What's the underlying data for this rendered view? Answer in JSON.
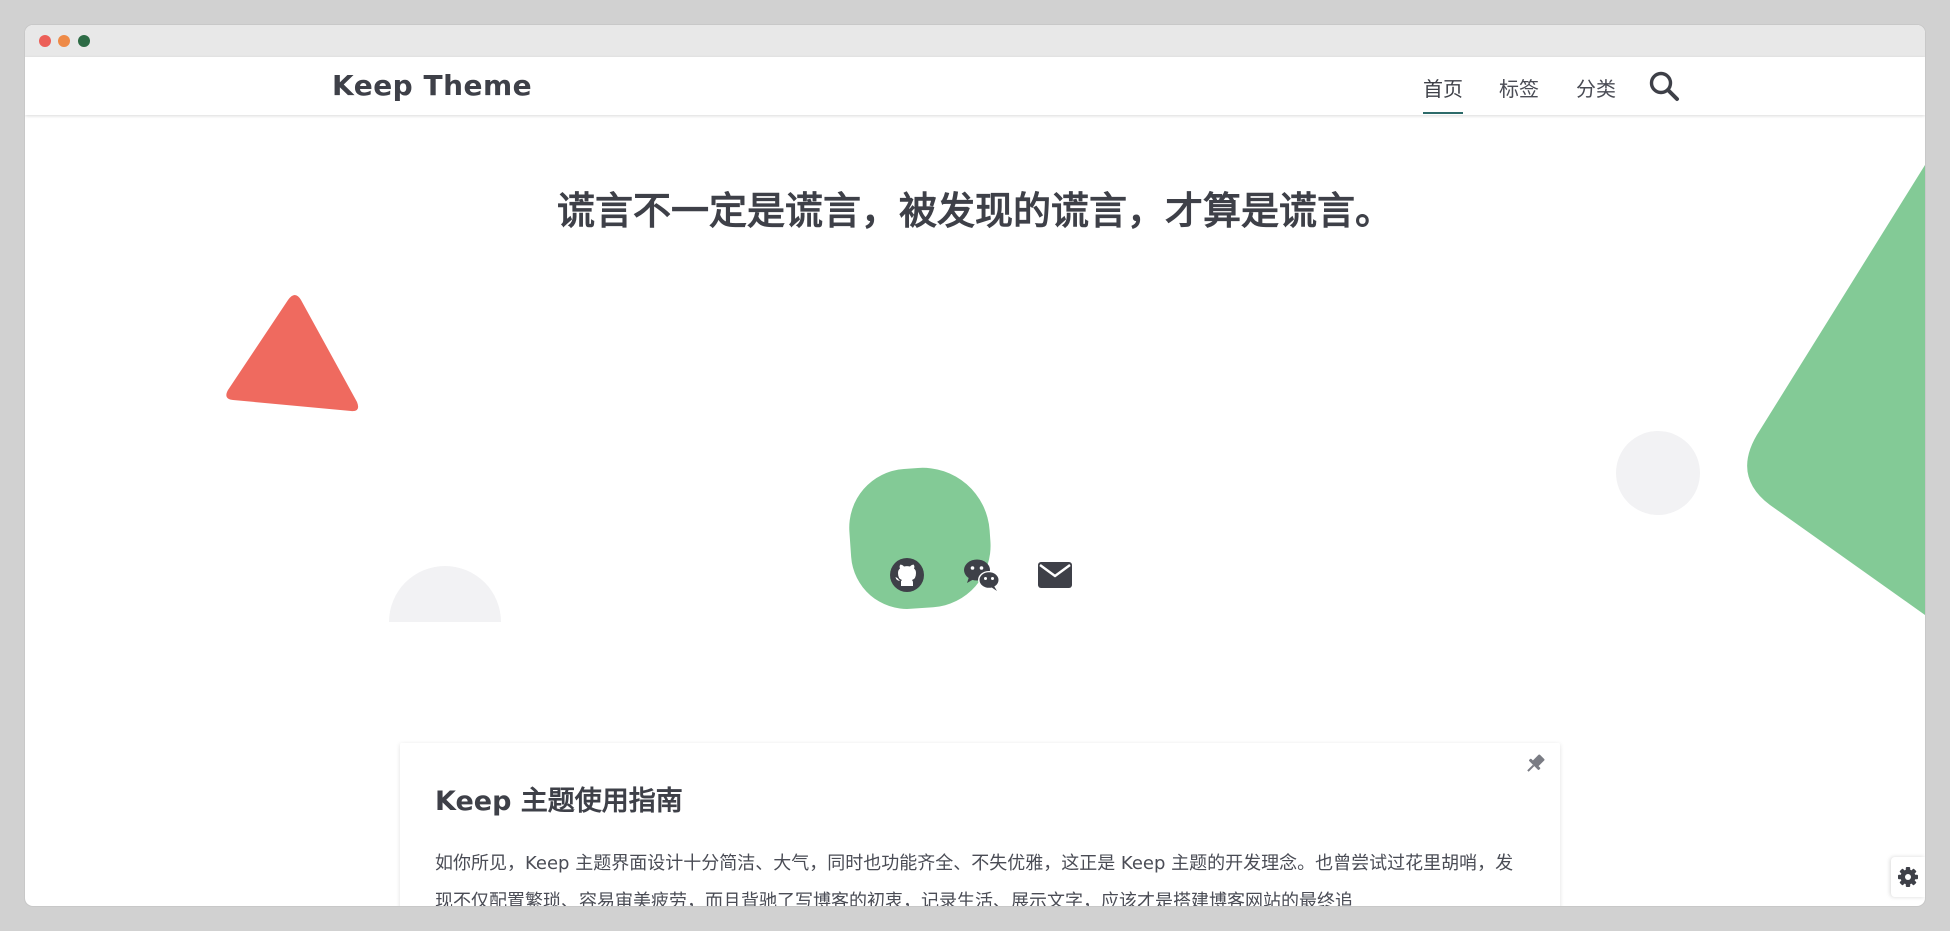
{
  "window": {
    "controls": [
      "close",
      "minimize",
      "maximize"
    ]
  },
  "header": {
    "site_title": "Keep Theme",
    "nav": [
      {
        "label": "首页",
        "active": true
      },
      {
        "label": "标签",
        "active": false
      },
      {
        "label": "分类",
        "active": false
      }
    ],
    "search_icon": "search-icon"
  },
  "hero": {
    "quote": "谎言不一定是谎言，被发现的谎言，才算是谎言。",
    "social_links": [
      {
        "name": "github",
        "icon": "github-icon"
      },
      {
        "name": "wechat",
        "icon": "wechat-icon"
      },
      {
        "name": "email",
        "icon": "mail-icon"
      }
    ]
  },
  "posts": [
    {
      "title": "Keep 主题使用指南",
      "pinned": true,
      "excerpt": "如你所见，Keep 主题界面设计十分简洁、大气，同时也功能齐全、不失优雅，这正是 Keep 主题的开发理念。也曾尝试过花里胡哨，发现不仅配置繁琐、容易审美疲劳，而且背驰了写博客的初衷，记录生活、展示文字，应该才是搭建博客网站的最终追"
    }
  ],
  "settings": {
    "icon": "gear-icon"
  },
  "colors": {
    "accent": "#2d6b6a",
    "text": "#3e4048",
    "green_shape": "#83ca96",
    "red_shape": "#ef6a5f",
    "grey_shape": "#f2f2f4"
  }
}
